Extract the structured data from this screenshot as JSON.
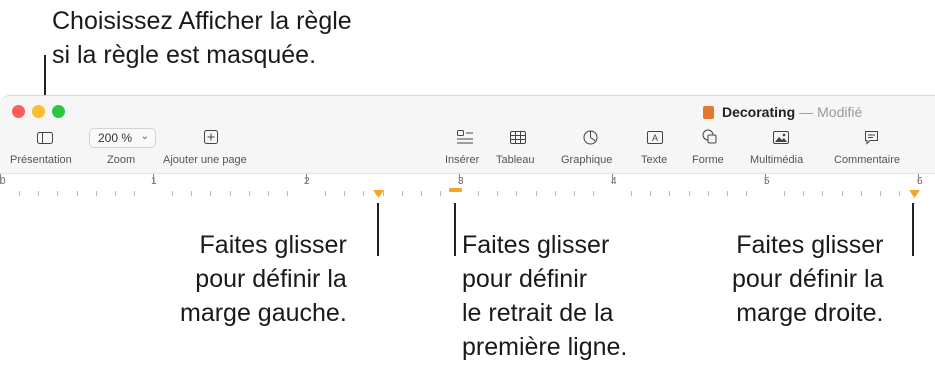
{
  "callouts": {
    "show_ruler": "Choisissez Afficher la règle\nsi la règle est masquée.",
    "left_margin": "Faites glisser\npour définir la\nmarge gauche.",
    "first_line": "Faites glisser\npour définir\nle retrait de la\npremière ligne.",
    "right_margin": "Faites glisser\npour définir la\nmarge droite."
  },
  "window": {
    "title": "Decorating",
    "separator": "—",
    "status": "Modifié",
    "traffic_colors": [
      "#fe5f57",
      "#febc2e",
      "#28c840"
    ]
  },
  "toolbar": {
    "presentation": "Présentation",
    "zoom_label": "Zoom",
    "zoom_value": "200 %",
    "add_page": "Ajouter une page",
    "insert": "Insérer",
    "table": "Tableau",
    "chart": "Graphique",
    "text": "Texte",
    "shape": "Forme",
    "media": "Multimédia",
    "comment": "Commentaire"
  },
  "ruler": {
    "numbers": [
      "0",
      "1",
      "2",
      "3",
      "4",
      "5",
      "6"
    ],
    "marker_color": "#f5a623"
  }
}
